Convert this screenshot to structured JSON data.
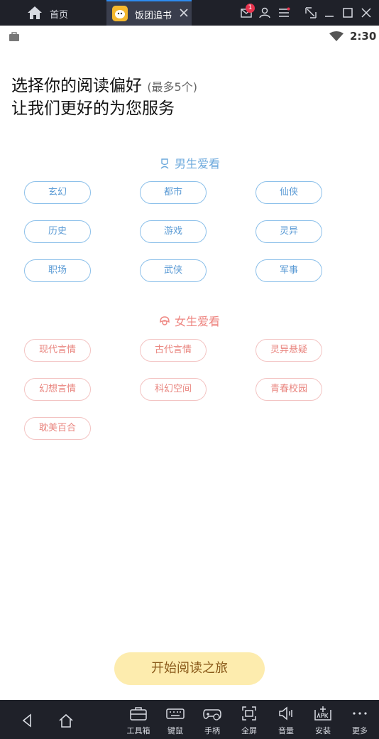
{
  "emulator": {
    "home_tab_label": "首页",
    "app_tab_label": "饭团追书",
    "mail_badge": "1"
  },
  "status_bar": {
    "time": "2:30"
  },
  "headline": {
    "line1": "选择你的阅读偏好",
    "hint": "(最多5个)",
    "line2": "让我们更好的为您服务"
  },
  "male_section": {
    "title": "男生爱看",
    "items": [
      "玄幻",
      "都市",
      "仙侠",
      "历史",
      "游戏",
      "灵异",
      "职场",
      "武侠",
      "军事"
    ]
  },
  "female_section": {
    "title": "女生爱看",
    "items": [
      "现代言情",
      "古代言情",
      "灵异悬疑",
      "幻想言情",
      "科幻空间",
      "青春校园",
      "耽美百合"
    ]
  },
  "start_button_label": "开始阅读之旅",
  "toolbar": {
    "items": [
      "工具箱",
      "键鼠",
      "手柄",
      "全屏",
      "音量",
      "安装",
      "更多"
    ]
  },
  "colors": {
    "male_accent": "#5b9bd5",
    "female_accent": "#e9857f",
    "start_button_bg": "#fdecae",
    "emulator_chrome": "#1f2129"
  },
  "icons": {
    "top_bar": [
      "home-icon",
      "app-logo-icon",
      "close-icon",
      "mail-icon",
      "user-icon",
      "menu-icon",
      "resize-icon",
      "minimize-icon",
      "maximize-icon",
      "window-close-icon"
    ],
    "status_bar": [
      "shopping-bag-icon",
      "wifi-icon"
    ],
    "sections": [
      "male-icon",
      "female-icon"
    ],
    "bottom_bar": [
      "back-icon",
      "android-home-icon",
      "toolbox-icon",
      "keyboard-icon",
      "gamepad-icon",
      "fullscreen-icon",
      "volume-icon",
      "apk-icon",
      "more-icon"
    ]
  }
}
